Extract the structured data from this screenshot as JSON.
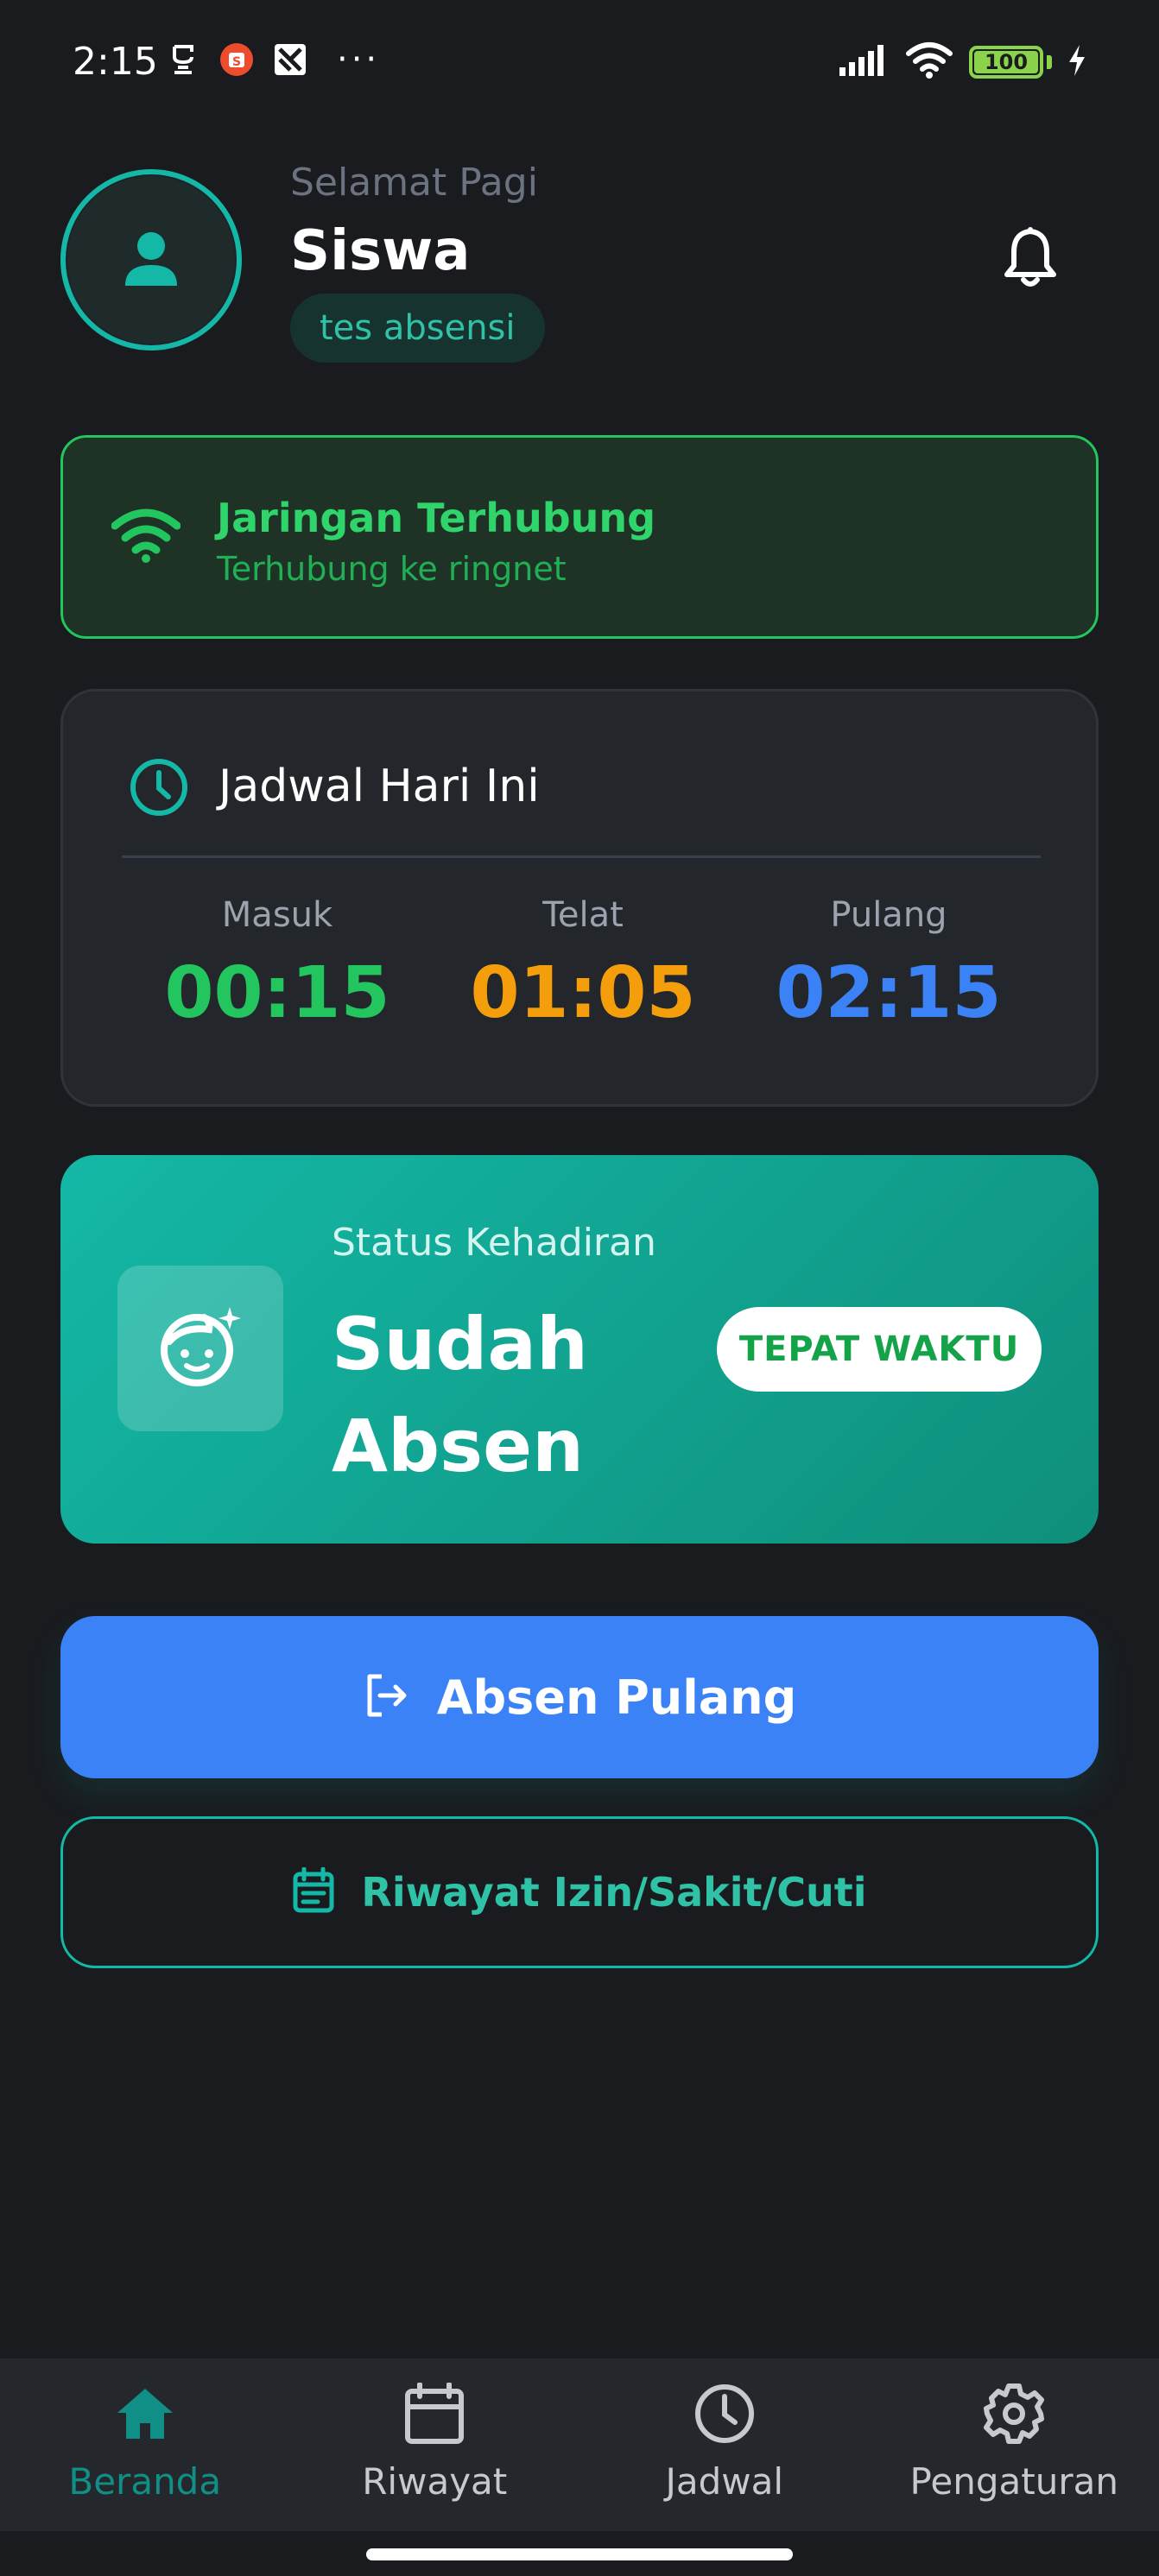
{
  "status_bar": {
    "time": "2:15",
    "battery": "100",
    "icons": [
      "message-icon",
      "shopee-icon",
      "app-icon",
      "more-icon",
      "signal-icon",
      "wifi-icon",
      "battery-icon",
      "charging-icon"
    ],
    "more": "···"
  },
  "header": {
    "greeting": "Selamat Pagi",
    "name": "Siswa",
    "class": "tes absensi"
  },
  "network": {
    "title": "Jaringan Terhubung",
    "subtitle": "Terhubung ke ringnet",
    "color": "#22c55e"
  },
  "schedule": {
    "title": "Jadwal Hari Ini",
    "items": [
      {
        "label": "Masuk",
        "time": "00:15",
        "color": "#22c55e"
      },
      {
        "label": "Telat",
        "time": "01:05",
        "color": "#f59e0b"
      },
      {
        "label": "Pulang",
        "time": "02:15",
        "color": "#3b82f6"
      }
    ]
  },
  "attendance": {
    "label": "Status Kehadiran",
    "status": "Sudah Absen",
    "badge": "TEPAT WAKTU",
    "accent": "#14b8a6"
  },
  "actions": {
    "primary": "Absen Pulang",
    "secondary": "Riwayat Izin/Sakit/Cuti"
  },
  "nav": {
    "items": [
      {
        "label": "Beranda",
        "icon": "home-icon",
        "active": true
      },
      {
        "label": "Riwayat",
        "icon": "calendar-icon",
        "active": false
      },
      {
        "label": "Jadwal",
        "icon": "clock-icon",
        "active": false
      },
      {
        "label": "Pengaturan",
        "icon": "gear-icon",
        "active": false
      }
    ]
  }
}
